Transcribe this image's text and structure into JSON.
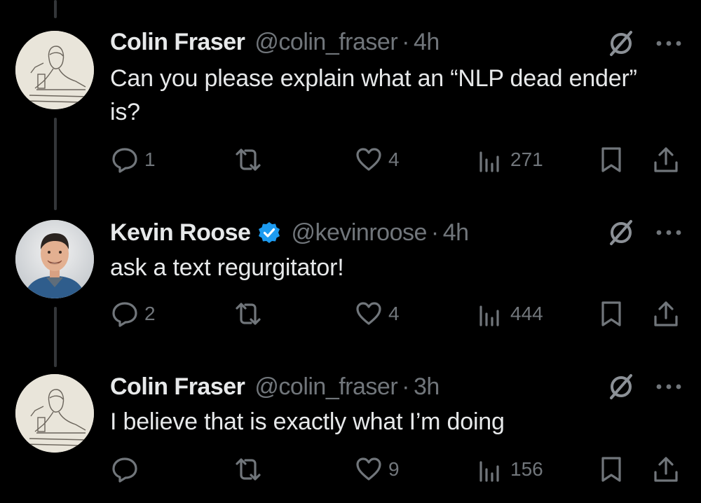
{
  "colors": {
    "background": "#000000",
    "text": "#e7e9ea",
    "secondary": "#71767b",
    "verified": "#1d9bf0"
  },
  "tweets": [
    {
      "name": "Colin Fraser",
      "handle": "@colin_fraser",
      "separator": "·",
      "time": "4h",
      "verified": false,
      "text": "Can you please explain what an “NLP dead ender” is?",
      "replies": "1",
      "reposts": "",
      "likes": "4",
      "views": "271"
    },
    {
      "name": "Kevin Roose",
      "handle": "@kevinroose",
      "separator": "·",
      "time": "4h",
      "verified": true,
      "text": "ask a text regurgitator!",
      "replies": "2",
      "reposts": "",
      "likes": "4",
      "views": "444"
    },
    {
      "name": "Colin Fraser",
      "handle": "@colin_fraser",
      "separator": "·",
      "time": "3h",
      "verified": false,
      "text": "I believe that is exactly what I’m doing",
      "replies": "",
      "reposts": "",
      "likes": "9",
      "views": "156"
    }
  ],
  "icons": {
    "reply": "reply-icon",
    "repost": "repost-icon",
    "like": "heart-icon",
    "views": "views-icon",
    "bookmark": "bookmark-icon",
    "share": "share-icon",
    "grok": "grok-icon",
    "more": "more-icon",
    "verified": "verified-badge-icon"
  }
}
